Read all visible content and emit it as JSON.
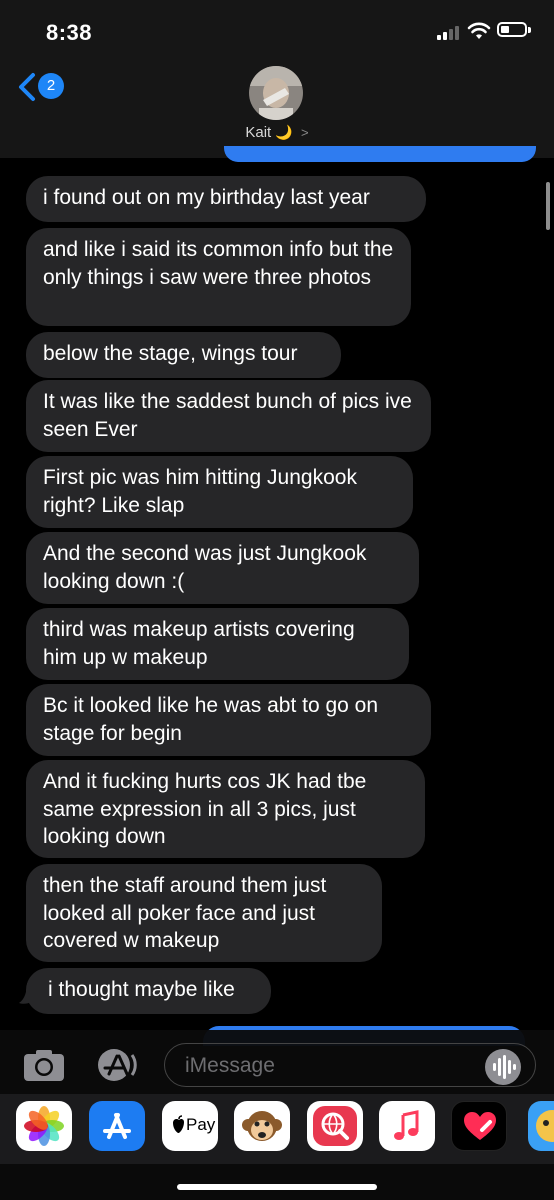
{
  "status_bar": {
    "time": "8:38"
  },
  "header": {
    "back_count": "2",
    "contact_name": "Kait",
    "contact_emoji": "🌙"
  },
  "messages": [
    {
      "text": "i found out on my birthday last year"
    },
    {
      "text": "and like i said its common info but the only things i saw were three photos"
    },
    {
      "text": "below the stage, wings tour"
    },
    {
      "text": "It was like the saddest bunch of pics ive seen Ever"
    },
    {
      "text": "First pic was him hitting Jungkook right? Like slap"
    },
    {
      "text": "And the second was just Jungkook looking down :("
    },
    {
      "text": "third was makeup artists covering him up w makeup"
    },
    {
      "text": "Bc it looked like he was abt to go on stage for begin"
    },
    {
      "text": "And it fucking hurts cos JK had tbe same expression in all 3 pics, just looking down"
    },
    {
      "text": "then the staff around them just looked all poker face and just covered w makeup"
    },
    {
      "text": "i thought maybe like"
    }
  ],
  "input": {
    "placeholder": "iMessage"
  },
  "app_drawer": {
    "apps": [
      {
        "icon": "photos-icon"
      },
      {
        "icon": "app-store-icon"
      },
      {
        "icon": "apple-pay-icon",
        "label": "Pay"
      },
      {
        "icon": "animoji-monkey-icon"
      },
      {
        "icon": "web-images-search-icon"
      },
      {
        "icon": "music-icon"
      },
      {
        "icon": "digital-touch-icon"
      },
      {
        "icon": "memoji-icon"
      }
    ]
  },
  "colors": {
    "bubble_incoming": "#262628",
    "bubble_outgoing": "#2f7cf0",
    "accent": "#1e86f7"
  }
}
